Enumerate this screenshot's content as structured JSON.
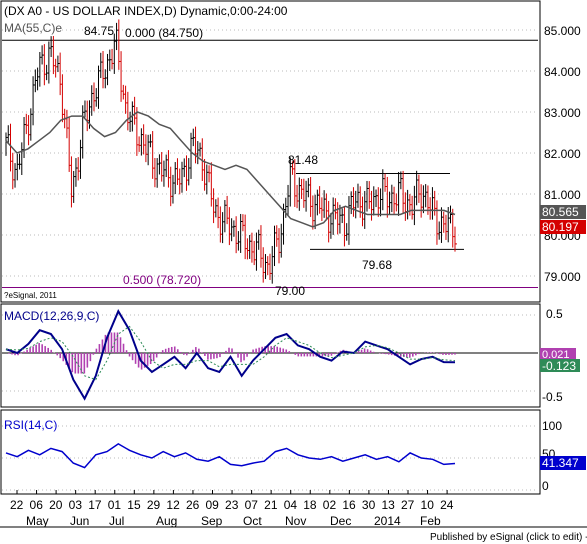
{
  "chart_data": [
    {
      "type": "line",
      "panel": "price",
      "title": "(DX A0 - US DOLLAR INDEX,D) Dynamic,0:00-24:00",
      "indicator_label": "MA(55,C)e",
      "y_ticks": [
        "85.000",
        "84.000",
        "83.000",
        "82.000",
        "81.000",
        "80.000",
        "79.000"
      ],
      "ylim": [
        78.5,
        85.3
      ],
      "last_ma": "80.565",
      "last_close": "80.197",
      "colors": {
        "up": "#000000",
        "down": "#d40000",
        "ma": "#555555",
        "fib": "#800080",
        "ma_badge": "#555555",
        "close_badge": "#d40000"
      },
      "annotations": [
        {
          "text": "84.75",
          "x": "Jul 01",
          "y": 84.75
        },
        {
          "text": "0.000 (84.750)",
          "x": "Jul 15",
          "y": 84.75
        },
        {
          "text": "81.48",
          "x": "Nov 04",
          "y": 81.48
        },
        {
          "text": "79.68",
          "x": "Dec 16",
          "y": 79.68
        },
        {
          "text": "79.00",
          "x": "Oct 21",
          "y": 79.0
        },
        {
          "text": "0.500 (78.720)",
          "x": "Jul 01",
          "y": 78.72
        }
      ],
      "levels": [
        {
          "label": "0.000 (84.750)",
          "value": 84.75,
          "color": "#000000"
        },
        {
          "label": "0.500 (78.720)",
          "value": 78.72,
          "color": "#800080"
        }
      ],
      "channel": {
        "top": 81.5,
        "bottom": 79.65,
        "from": "Nov 04",
        "to": "Feb 17"
      },
      "series": [
        {
          "name": "MA(55,C)e",
          "values": [
            82.3,
            82.0,
            82.1,
            82.3,
            82.5,
            82.8,
            82.9,
            82.9,
            82.6,
            82.4,
            82.5,
            82.8,
            83.0,
            82.9,
            82.7,
            82.6,
            82.3,
            82.0,
            81.8,
            81.7,
            81.6,
            81.7,
            81.6,
            81.3,
            81.0,
            80.7,
            80.4,
            80.3,
            80.2,
            80.3,
            80.6,
            80.7,
            80.6,
            80.5,
            80.5,
            80.5,
            80.5,
            80.6,
            80.6,
            80.6,
            80.6,
            80.5
          ]
        }
      ],
      "closes": [
        82.2,
        81.5,
        82.8,
        84.1,
        84.4,
        83.8,
        81.0,
        82.6,
        83.5,
        84.0,
        84.7,
        83.0,
        82.5,
        82.0,
        81.6,
        81.4,
        81.3,
        82.2,
        81.8,
        80.6,
        80.3,
        80.1,
        79.8,
        79.6,
        79.2,
        80.0,
        81.4,
        81.0,
        80.8,
        80.6,
        80.4,
        80.3,
        80.9,
        80.7,
        81.0,
        80.9,
        81.0,
        80.7,
        81.1,
        80.5,
        80.2,
        80.197
      ]
    },
    {
      "type": "line",
      "panel": "macd",
      "title": "MACD(12,26,9,C)",
      "y_ticks": [
        "0.5",
        "-0.5"
      ],
      "ylim": [
        -0.75,
        0.72
      ],
      "badges": [
        "0.021",
        "-0.123"
      ],
      "colors": {
        "macd": "#00008b",
        "signal": "#2e8b57",
        "histogram": "#b040b0"
      },
      "series": [
        {
          "name": "MACD",
          "values": [
            0.05,
            0.0,
            0.12,
            0.3,
            0.25,
            0.05,
            -0.35,
            -0.6,
            -0.3,
            0.2,
            0.55,
            0.3,
            -0.1,
            -0.25,
            -0.15,
            -0.05,
            -0.2,
            0.0,
            -0.2,
            -0.25,
            -0.05,
            -0.3,
            -0.1,
            0.05,
            0.2,
            0.25,
            0.1,
            0.05,
            -0.05,
            -0.1,
            0.02,
            0.0,
            0.15,
            0.1,
            0.05,
            -0.05,
            -0.15,
            -0.08,
            -0.05,
            -0.12,
            -0.123
          ]
        },
        {
          "name": "Signal",
          "values": [
            0.05,
            0.04,
            0.06,
            0.15,
            0.2,
            0.15,
            -0.05,
            -0.3,
            -0.35,
            -0.1,
            0.25,
            0.35,
            0.15,
            -0.1,
            -0.2,
            -0.15,
            -0.15,
            -0.1,
            -0.1,
            -0.18,
            -0.15,
            -0.15,
            -0.15,
            -0.05,
            0.1,
            0.2,
            0.15,
            0.1,
            0.0,
            -0.06,
            -0.03,
            0.0,
            0.08,
            0.1,
            0.07,
            0.0,
            -0.08,
            -0.08,
            -0.06,
            -0.09,
            -0.1
          ]
        }
      ]
    },
    {
      "type": "line",
      "panel": "rsi",
      "title": "RSI(14,C)",
      "y_ticks": [
        "100",
        "50",
        "0"
      ],
      "ylim": [
        0,
        100
      ],
      "badge": "41.347",
      "colors": {
        "rsi": "#0000cd"
      },
      "values": [
        58,
        52,
        62,
        55,
        65,
        60,
        42,
        35,
        55,
        60,
        72,
        62,
        55,
        50,
        60,
        52,
        58,
        48,
        45,
        52,
        40,
        38,
        42,
        45,
        60,
        65,
        55,
        50,
        48,
        52,
        45,
        50,
        55,
        48,
        52,
        44,
        58,
        50,
        48,
        40,
        41.347
      ]
    }
  ],
  "x_axis": {
    "day_ticks": [
      "22",
      "06",
      "20",
      "03",
      "17",
      "01",
      "15",
      "29",
      "12",
      "26",
      "09",
      "23",
      "07",
      "21",
      "04",
      "18",
      "02",
      "16",
      "30",
      "13",
      "27",
      "10",
      "24"
    ],
    "month_labels": [
      "May",
      "Jun",
      "Jul",
      "Aug",
      "Sep",
      "Oct",
      "Nov",
      "Dec",
      "2014",
      "Feb"
    ]
  },
  "watermark": "?eSignal, 2011",
  "footer": "Published by eSignal (click to edit) - www.esignal.com"
}
